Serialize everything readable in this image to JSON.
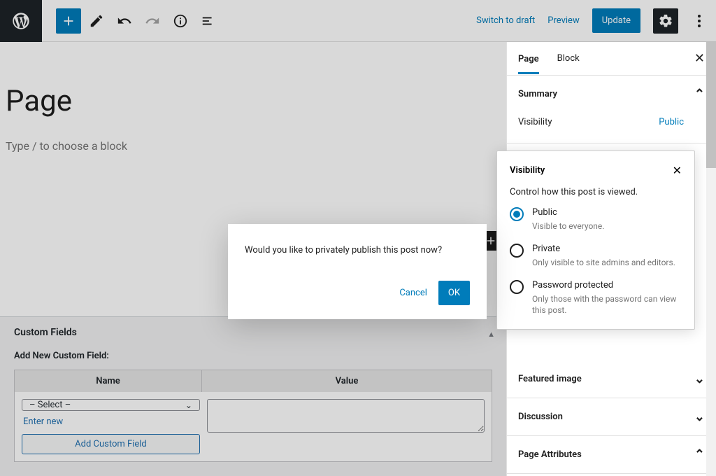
{
  "topbar": {
    "switch_to_draft": "Switch to draft",
    "preview": "Preview",
    "update": "Update"
  },
  "editor": {
    "title": "Page",
    "block_placeholder": "Type / to choose a block"
  },
  "custom_fields": {
    "panel_title": "Custom Fields",
    "add_new_label": "Add New Custom Field:",
    "col_name": "Name",
    "col_value": "Value",
    "select_placeholder": "– Select –",
    "enter_new": "Enter new",
    "add_button": "Add Custom Field"
  },
  "sidebar": {
    "tabs": {
      "page": "Page",
      "block": "Block"
    },
    "panels": {
      "summary": {
        "title": "Summary",
        "visibility_label": "Visibility",
        "visibility_value": "Public"
      },
      "featured_image": "Featured image",
      "discussion": "Discussion",
      "page_attributes": "Page Attributes"
    }
  },
  "visibility_popover": {
    "title": "Visibility",
    "description": "Control how this post is viewed.",
    "options": [
      {
        "label": "Public",
        "sub": "Visible to everyone.",
        "selected": true
      },
      {
        "label": "Private",
        "sub": "Only visible to site admins and editors.",
        "selected": false
      },
      {
        "label": "Password protected",
        "sub": "Only those with the password can view this post.",
        "selected": false
      }
    ]
  },
  "modal": {
    "text": "Would you like to privately publish this post now?",
    "cancel": "Cancel",
    "ok": "OK"
  }
}
